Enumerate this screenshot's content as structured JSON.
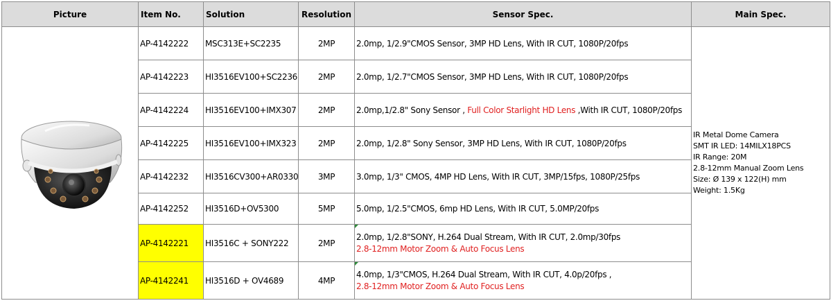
{
  "headers": {
    "picture": "Picture",
    "item_no": "Item No.",
    "solution": "Solution",
    "resolution": "Resolution",
    "sensor_spec": "Sensor Spec.",
    "main_spec": "Main Spec."
  },
  "rows": [
    {
      "item": "AP-4142222",
      "solution": "MSC313E+SC2235",
      "resolution": "2MP",
      "sensor_a": "2.0mp, 1/2.9\"CMOS Sensor, 3MP HD Lens, With IR CUT, 1080P/20fps",
      "sensor_red": "",
      "sensor_b": ""
    },
    {
      "item": "AP-4142223",
      "solution": "HI3516EV100+SC2236",
      "resolution": "2MP",
      "sensor_a": "2.0mp, 1/2.7\"CMOS Sensor, 3MP HD Lens, With IR CUT, 1080P/20fps",
      "sensor_red": "",
      "sensor_b": ""
    },
    {
      "item": "AP-4142224",
      "solution": "HI3516EV100+IMX307",
      "resolution": "2MP",
      "sensor_a": "2.0mp,1/2.8\" Sony Sensor , ",
      "sensor_red": "Full Color Starlight HD Lens",
      "sensor_b": " ,With IR CUT, 1080P/20fps"
    },
    {
      "item": "AP-4142225",
      "solution": "HI3516EV100+IMX323",
      "resolution": "2MP",
      "sensor_a": "2.0mp, 1/2.8\" Sony Sensor, 3MP HD Lens, With IR CUT, 1080P/20fps",
      "sensor_red": "",
      "sensor_b": ""
    },
    {
      "item": "AP-4142232",
      "solution": "HI3516CV300+AR0330",
      "resolution": "3MP",
      "sensor_a": "3.0mp, 1/3\" CMOS, 4MP  HD Lens, With IR CUT, 3MP/15fps, 1080P/25fps",
      "sensor_red": "",
      "sensor_b": ""
    },
    {
      "item": "AP-4142252",
      "solution": "HI3516D+OV5300",
      "resolution": "5MP",
      "sensor_a": "5.0mp, 1/2.5\"CMOS, 6mp HD Lens, With IR CUT,  5.0MP/20fps",
      "sensor_red": "",
      "sensor_b": ""
    },
    {
      "item": "AP-4142221",
      "solution": "HI3516C + SONY222",
      "resolution": "2MP",
      "sensor_line1": "2.0mp, 1/2.8\"SONY, H.264 Dual Stream, With  IR CUT, 2.0mp/30fps",
      "sensor_line2": "2.8-12mm Motor Zoom & Auto Focus Lens"
    },
    {
      "item": "AP-4142241",
      "solution": "HI3516D + OV4689",
      "resolution": "4MP",
      "sensor_line1": "4.0mp, 1/3\"CMOS, H.264 Dual Stream, With  IR CUT, 4.0p/20fps ,",
      "sensor_line2": "2.8-12mm Motor Zoom & Auto Focus Lens"
    }
  ],
  "main_spec": [
    "IR Metal Dome Camera",
    "SMT IR LED: 14MILX18PCS",
    "IR Range: 20M",
    "2.8-12mm Manual Zoom Lens",
    "Size: Ø 139 x 122(H) mm",
    "Weight: 1.5Kg"
  ],
  "colors": {
    "header_bg": "#dcdcdc",
    "highlight": "#ffff00",
    "emphasis_red": "#e02020",
    "border": "#8c8c8c"
  },
  "picture_icon": "dome-camera-icon"
}
